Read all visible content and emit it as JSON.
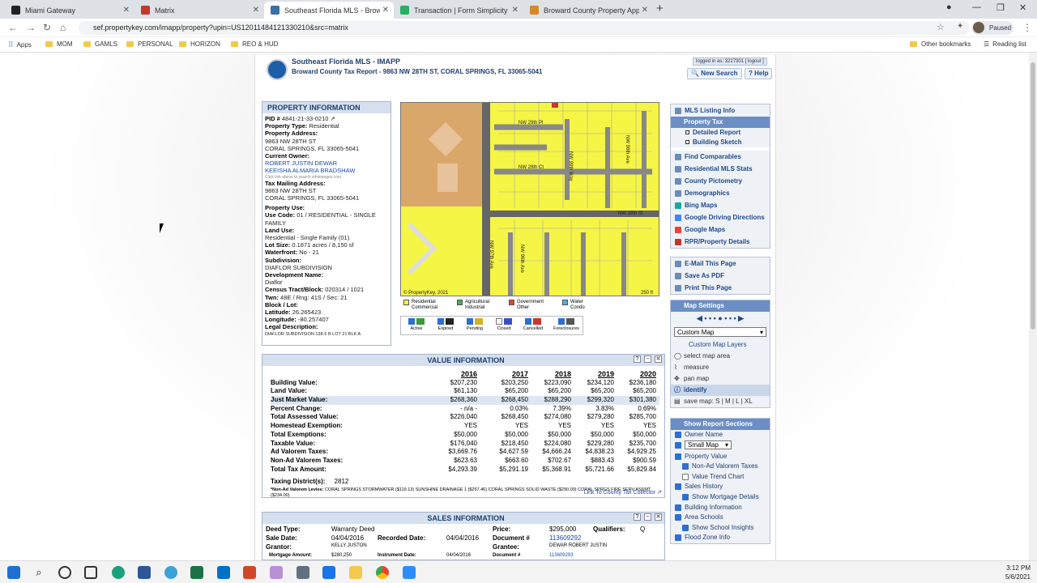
{
  "browser": {
    "tabs": [
      {
        "title": "Miami Gateway",
        "color": "#222222"
      },
      {
        "title": "Matrix",
        "color": "#c0392b"
      },
      {
        "title": "Southeast Florida MLS - Broward",
        "color": "#3a6ea5"
      },
      {
        "title": "Transaction | Form Simplicity",
        "color": "#27ae60"
      },
      {
        "title": "Broward County Property Appra",
        "color": "#d4892a"
      }
    ],
    "url": "sef.propertykey.com/imapp/property?upin=US12011484121330210&src=matrix",
    "profile_status": "Paused",
    "bookmarks": [
      "Apps",
      "MOM",
      "GAMLS",
      "PERSONAL",
      "HORIZON",
      "REO & HUD"
    ],
    "other_bookmarks": "Other bookmarks",
    "reading_list": "Reading list"
  },
  "header": {
    "title": "Southeast Florida MLS - IMAPP",
    "subtitle": "Broward County Tax Report - 9863 NW 28TH ST, CORAL SPRINGS, FL 33065-5041",
    "logged_in": "logged in as: 3227301 [ logout ]",
    "new_search": "New Search",
    "help": "Help"
  },
  "property_info": {
    "heading": "PROPERTY INFORMATION",
    "pid_label": "PID #",
    "pid": "4841-21-33-0210",
    "type_label": "Property Type:",
    "type": "Residential",
    "address_label": "Property Address:",
    "address1": "9863 NW 28TH ST",
    "address2": "CORAL SPRINGS, FL 33065-5041",
    "owner_label": "Current Owner:",
    "owner1": "ROBERT JUSTIN DEWAR",
    "owner2": "KEEISHA ALMARIA BRADSHAW",
    "owner_note": "Click link above to search whitepages.com",
    "mail_label": "Tax Mailing Address:",
    "mail1": "9863 NW 28TH ST",
    "mail2": "CORAL SPRINGS, FL 33065-5041",
    "use_label": "Property Use:",
    "usecode_label": "Use Code:",
    "usecode": "01 / RESIDENTIAL - SINGLE FAMILY",
    "landuse_label": "Land Use:",
    "landuse": "Residential - Single Family (01)",
    "lot_label": "Lot Size:",
    "lot": "0.1871 acres / 8,150 sf",
    "water_label": "Waterfront:",
    "water": "No - 21",
    "subdiv_label": "Subdivision:",
    "subdiv": "DIAFLOR SUBDIVISION",
    "dev_label": "Development Name:",
    "dev": "Diaflor",
    "census_label": "Census Tract/Block:",
    "census": "020314 / 1021",
    "twn_label": "Twn:",
    "twn": "48E / Rng: 41S / Sec: 21",
    "block_label": "Block / Lot:",
    "lat_label": "Latitude:",
    "lat": "26.265423",
    "lon_label": "Longitude:",
    "lon": "-80.257407",
    "legal_label": "Legal Description:",
    "legal": "DIAFLOR SUBDIVISION 138-5 B LOT 21 BLK A"
  },
  "map": {
    "streets": [
      "NW 29th Pl",
      "NW 28th Ct",
      "NW 28th St",
      "NW 99th Way",
      "NW 98th Ave",
      "NW 97th Ave",
      "NW 96th Ave"
    ],
    "credit": "© PropertyKey, 2021",
    "scale": "250 ft"
  },
  "legend": [
    {
      "label": "Residential Commercial",
      "color": "#f5f545"
    },
    {
      "label": "Agricultural Industrial",
      "color": "#4caf50"
    },
    {
      "label": "Government Other",
      "color": "#e0452a"
    },
    {
      "label": "Water Condo",
      "color": "#4ab0e6"
    }
  ],
  "layers": [
    "Active",
    "Expired",
    "Pending",
    "Closed",
    "Cancelled",
    "Foreclosures"
  ],
  "sidebar": {
    "mls_listing": "MLS Listing Info",
    "property_tax": "Property Tax",
    "detailed_report": "Detailed Report",
    "building_sketch": "Building Sketch",
    "links": [
      "Find Comparables",
      "Residential MLS Stats",
      "County Pictometry",
      "Demographics",
      "Bing Maps",
      "Google Driving Directions",
      "Google Maps",
      "RPR/Property Details"
    ],
    "actions": [
      "E-Mail This Page",
      "Save As PDF",
      "Print This Page"
    ],
    "map_settings": "Map Settings",
    "map_select": "Custom Map",
    "custom_layers": "Custom Map Layers",
    "tools": [
      "select map area",
      "measure",
      "pan map",
      "identify"
    ],
    "save_map": "save map: S | M | L | XL",
    "report_sections": "Show Report Sections",
    "sections": [
      {
        "label": "Owner Name",
        "on": true,
        "indent": false
      },
      {
        "label": "Small Map",
        "on": true,
        "indent": false
      },
      {
        "label": "Property Value",
        "on": true,
        "indent": false
      },
      {
        "label": "Non-Ad Valorem Taxes",
        "on": true,
        "indent": true
      },
      {
        "label": "Value Trend Chart",
        "on": false,
        "indent": true
      },
      {
        "label": "Sales History",
        "on": true,
        "indent": false
      },
      {
        "label": "Show Mortgage Details",
        "on": true,
        "indent": true
      },
      {
        "label": "Building Information",
        "on": true,
        "indent": false
      },
      {
        "label": "Area Schools",
        "on": true,
        "indent": false
      },
      {
        "label": "Show School Insights",
        "on": true,
        "indent": true
      },
      {
        "label": "Flood Zone Info",
        "on": true,
        "indent": false
      }
    ]
  },
  "value_info": {
    "heading": "VALUE INFORMATION",
    "years": [
      "2016",
      "2017",
      "2018",
      "2019",
      "2020"
    ],
    "rows": [
      {
        "label": "Building Value:",
        "values": [
          "$207,230",
          "$203,250",
          "$223,090",
          "$234,120",
          "$236,180"
        ]
      },
      {
        "label": "Land Value:",
        "values": [
          "$61,130",
          "$65,200",
          "$65,200",
          "$65,200",
          "$65,200"
        ]
      },
      {
        "label": "Just Market Value:",
        "values": [
          "$268,360",
          "$268,450",
          "$288,290",
          "$299,320",
          "$301,380"
        ]
      },
      {
        "label": "Percent Change:",
        "values": [
          "- n/a -",
          "0.03%",
          "7.39%",
          "3.83%",
          "0.69%"
        ]
      },
      {
        "label": "Total Assessed Value:",
        "values": [
          "$226,040",
          "$268,450",
          "$274,080",
          "$279,280",
          "$285,700"
        ]
      },
      {
        "label": "Homestead Exemption:",
        "values": [
          "YES",
          "YES",
          "YES",
          "YES",
          "YES"
        ]
      },
      {
        "label": "Total Exemptions:",
        "values": [
          "$50,000",
          "$50,000",
          "$50,000",
          "$50,000",
          "$50,000"
        ]
      },
      {
        "label": "Taxable Value:",
        "values": [
          "$176,040",
          "$218,450",
          "$224,080",
          "$229,280",
          "$235,700"
        ]
      },
      {
        "label": "Ad Valorem Taxes:",
        "values": [
          "$3,669.76",
          "$4,627.59",
          "$4,666.24",
          "$4,838.23",
          "$4,929.25"
        ]
      },
      {
        "label": "Non-Ad Valorem Taxes:",
        "values": [
          "$623.63",
          "$663.60",
          "$702.67",
          "$883.43",
          "$900.59"
        ]
      },
      {
        "label": "Total Tax Amount:",
        "values": [
          "$4,293.39",
          "$5,291.19",
          "$5,368.91",
          "$5,721.66",
          "$5,829.84"
        ]
      }
    ],
    "taxing_label": "Taxing District(s):",
    "taxing": "2812",
    "levies_label": "*Non-Ad Valorem Levies:",
    "levies": "CORAL SPRINGS STORMWATER ($119.13) SUNSHINE DRAINAGE 1 ($257.46) CORAL SPRINGS SOLID WASTE ($290.00) CORAL SPRGS FIRE SERV ASSMT ($234.00)",
    "collector_link": "Link To County Tax Collector"
  },
  "sales_info": {
    "heading": "SALES INFORMATION",
    "deed_type_label": "Deed Type:",
    "deed_type": "Warranty Deed",
    "price_label": "Price:",
    "price": "$295,000",
    "qualifiers_label": "Qualifiers:",
    "qualifiers": "Q",
    "sale_date_label": "Sale Date:",
    "sale_date": "04/04/2016",
    "recorded_label": "Recorded Date:",
    "recorded": "04/04/2016",
    "doc_label": "Document #",
    "doc": "113609292",
    "grantor_label": "Grantor:",
    "grantor": "KELLY JUSTON",
    "grantee_label": "Grantee:",
    "grantee": "DEWAR ROBERT JUSTIN",
    "mortgage_label": "Mortgage Amount:",
    "mortgage": "$280,250",
    "instr_label": "Instrument Date:",
    "instr": "04/04/2016",
    "doc2_label": "Document #",
    "doc2": "113609293"
  },
  "taskbar": {
    "time": "3:12 PM",
    "date": "5/6/2021"
  }
}
